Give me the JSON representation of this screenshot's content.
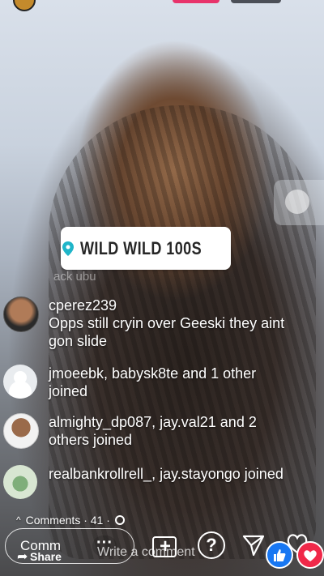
{
  "location": {
    "name": "WILD WILD 100S"
  },
  "ghost_text": "ack ubu",
  "comments": [
    {
      "user": "cperez239",
      "text": "Opps still cryin over Geeski they aint gon slide"
    },
    {
      "text": "jmoeebk, babysk8te and 1 other joined"
    },
    {
      "text": "almighty_dp087, jay.val21 and 2 others joined"
    },
    {
      "text": "realbankrollrell_, jay.stayongo joined"
    }
  ],
  "comments_bar": {
    "label": "Comments · 41 ·"
  },
  "bottom": {
    "comment_label": "Comm",
    "share_label": "Share",
    "dots_label": "···",
    "write_placeholder": "Write a comment",
    "help_label": "?"
  },
  "colors": {
    "live": "#e8336b",
    "like": "#1877f2",
    "love": "#f02849",
    "pin": "#1fb5c9"
  }
}
